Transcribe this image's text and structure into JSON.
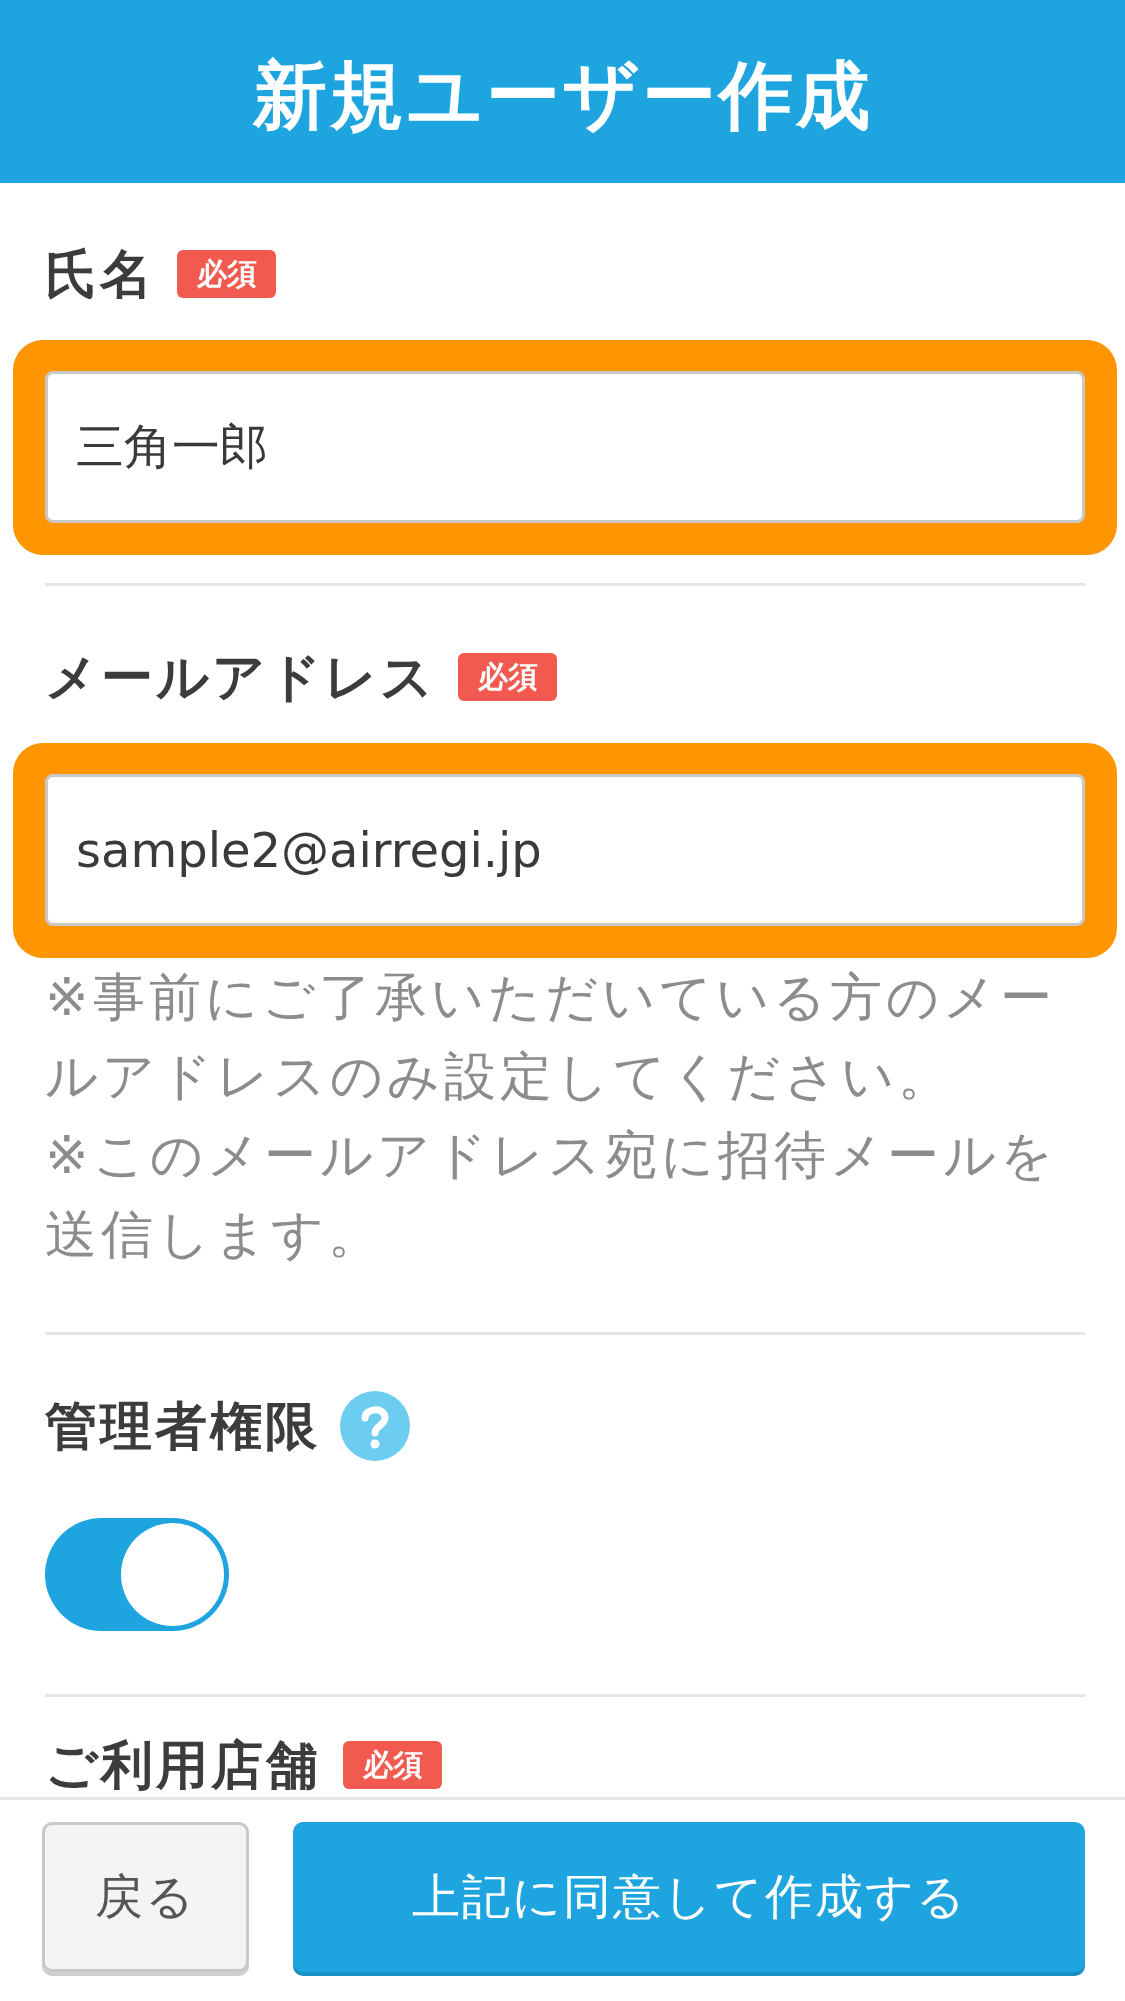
{
  "header": {
    "title": "新規ユーザー作成"
  },
  "fields": [
    {
      "kind": "text",
      "label": "氏名",
      "required_badge": "必須",
      "value": "三角一郎",
      "highlighted": true
    },
    {
      "kind": "text",
      "label": "メールアドレス",
      "required_badge": "必須",
      "value": "sample2@airregi.jp",
      "highlighted": true,
      "notes": [
        "※事前にご了承いただいている方のメールアドレスのみ設定してください。",
        "※このメールアドレス宛に招待メールを送信します。"
      ]
    },
    {
      "kind": "toggle",
      "label": "管理者権限",
      "help": true,
      "on": true
    },
    {
      "kind": "section",
      "label": "ご利用店舗",
      "required_badge": "必須"
    }
  ],
  "footer": {
    "buttons": [
      {
        "kind": "secondary",
        "label": "戻る"
      },
      {
        "kind": "primary",
        "label": "上記に同意して作成する"
      }
    ]
  }
}
